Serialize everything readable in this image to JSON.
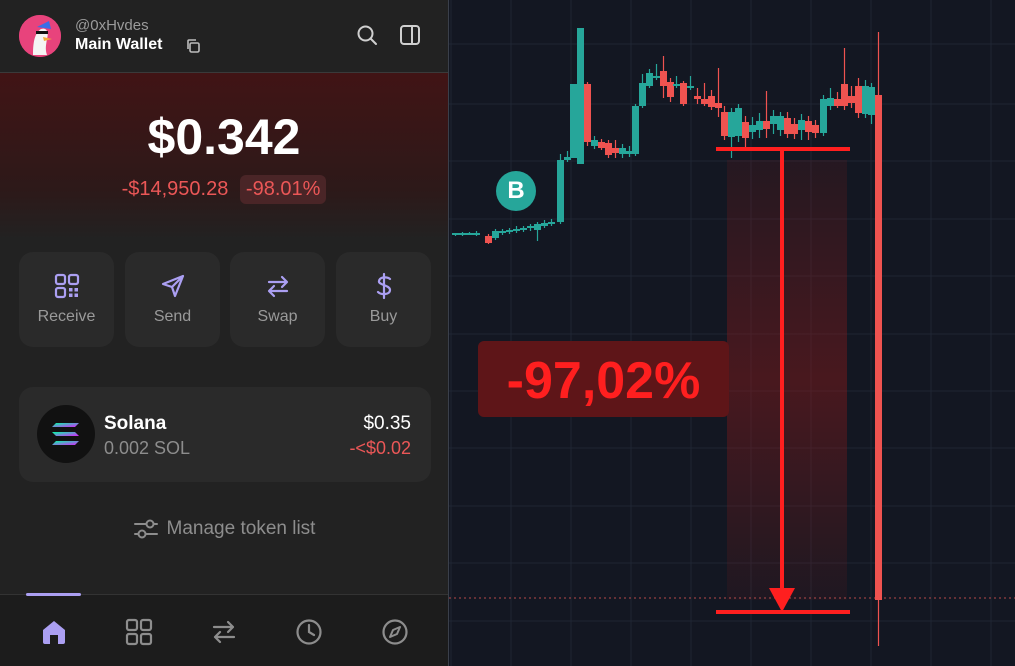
{
  "header": {
    "handle": "@0xHvdes",
    "wallet_name": "Main Wallet"
  },
  "balance": {
    "amount": "$0.342",
    "change_usd": "-$14,950.28",
    "change_pct": "-98.01%"
  },
  "actions": [
    {
      "label": "Receive",
      "icon": "qr-code-icon"
    },
    {
      "label": "Send",
      "icon": "send-icon"
    },
    {
      "label": "Swap",
      "icon": "swap-icon"
    },
    {
      "label": "Buy",
      "icon": "dollar-icon"
    }
  ],
  "token": {
    "name": "Solana",
    "amount": "0.002 SOL",
    "value": "$0.35",
    "change": "-<$0.02"
  },
  "manage_label": "Manage token list",
  "nav": [
    "home-icon",
    "grid-icon",
    "swap-icon",
    "history-icon",
    "explore-icon"
  ],
  "chart": {
    "badge": "B",
    "callout": "-97,02%"
  },
  "colors": {
    "accent": "#ab9ff2",
    "negative": "#eb5757",
    "candle_up": "#26a69a",
    "candle_down": "#ef5350",
    "annotation": "#ff1f1f"
  }
}
